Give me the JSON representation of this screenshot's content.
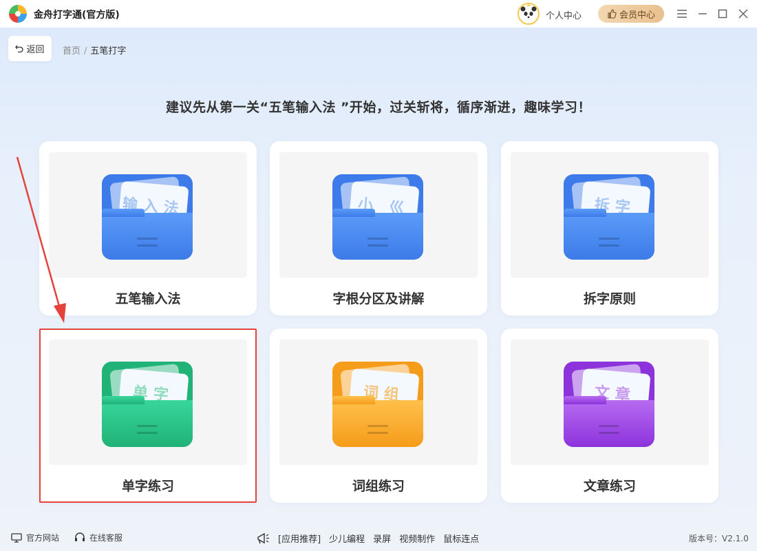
{
  "app": {
    "title": "金舟打字通(官方版)",
    "personal_center": "个人中心",
    "vip_center": "会员中心"
  },
  "nav": {
    "back_label": "返回",
    "breadcrumb": [
      "首页",
      "五笔打字"
    ]
  },
  "heading": "建议先从第一关“五笔输入法 ”开始，过关斩将，循序渐进，趣味学习！",
  "cards": [
    {
      "label": "五笔输入法",
      "icon_text": "输入法",
      "icon": "blue-folder-icon",
      "color_top": "#5b9bf7",
      "color_bottom": "#3c7be9",
      "text_color": "#a8c6f2"
    },
    {
      "label": "字根分区及讲解",
      "icon_text": "小 巛",
      "icon": "blue-folder-icon",
      "color_top": "#5b9bf7",
      "color_bottom": "#3c7be9",
      "text_color": "#a8c6f2"
    },
    {
      "label": "拆字原则",
      "icon_text": "拆字",
      "icon": "blue-folder-icon",
      "color_top": "#5b9bf7",
      "color_bottom": "#3c7be9",
      "text_color": "#a8c6f2"
    },
    {
      "label": "单字练习",
      "icon_text": "单字",
      "icon": "green-folder-icon",
      "color_top": "#38d69a",
      "color_bottom": "#20b277",
      "text_color": "#8fdcbd"
    },
    {
      "label": "词组练习",
      "icon_text": "词组",
      "icon": "orange-folder-icon",
      "color_top": "#ffc04a",
      "color_bottom": "#f59c1a",
      "text_color": "#f4c57a"
    },
    {
      "label": "文章练习",
      "icon_text": "文章",
      "icon": "purple-folder-icon",
      "color_top": "#b66bf0",
      "color_bottom": "#8c33dc",
      "text_color": "#c99cef"
    }
  ],
  "selected_card": "单字练习",
  "footer": {
    "official_site": "官方网站",
    "online_service": "在线客服",
    "recommend": "[应用推荐]",
    "apps": [
      "少儿编程",
      "录屏",
      "视频制作",
      "鼠标连点"
    ],
    "version": "版本号：V2.1.0"
  },
  "colors": {
    "accent_red": "#e5423b",
    "vip_gold": "#e9c08f"
  }
}
